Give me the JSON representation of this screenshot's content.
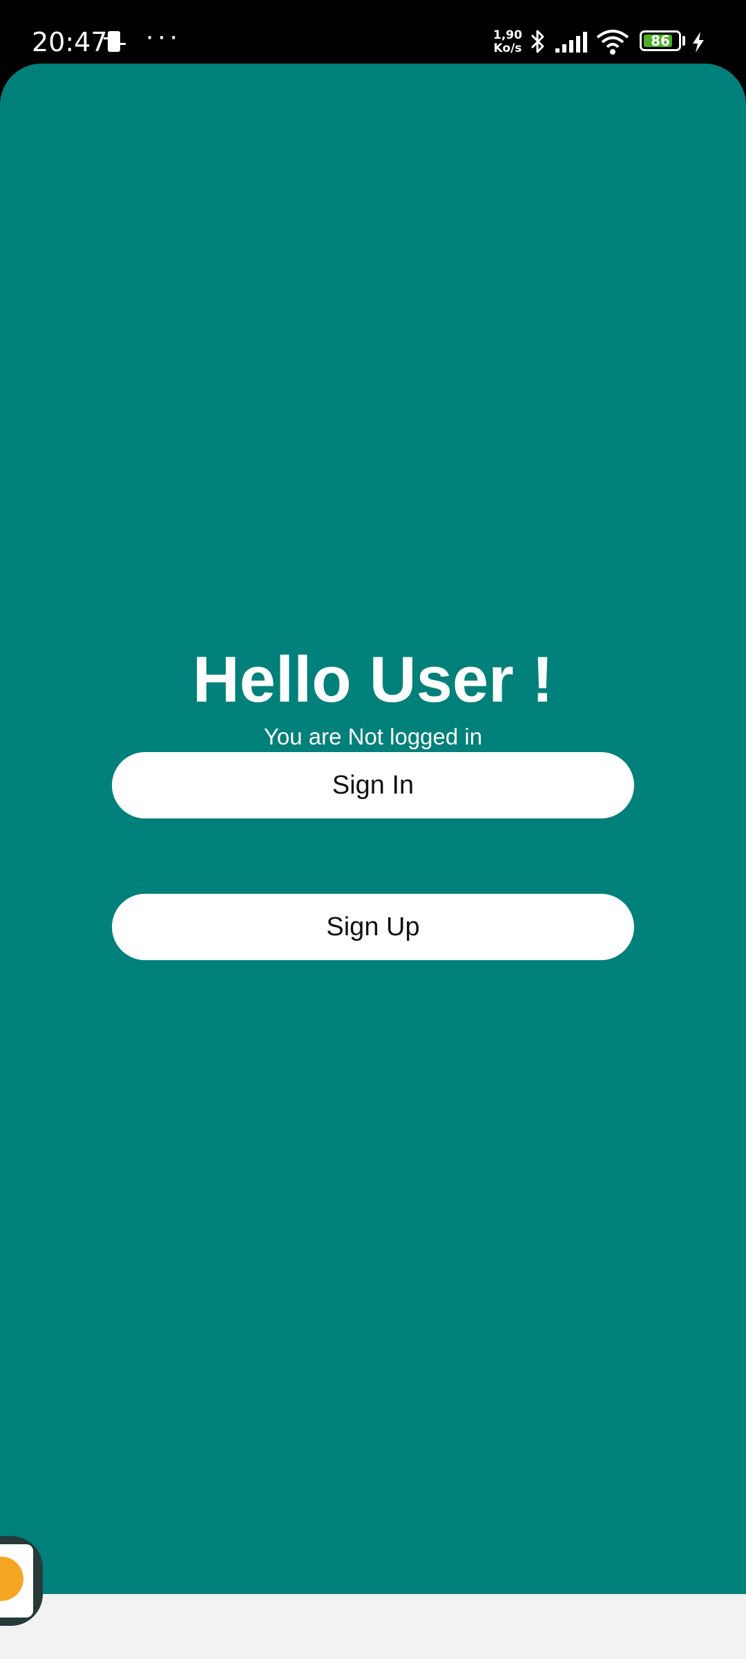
{
  "status_bar": {
    "time": "20:47",
    "more": "···",
    "net_speed_value": "1,90",
    "net_speed_unit": "Ko/s",
    "battery": "86",
    "battery_level": 0.86,
    "icons": [
      "phone-icon",
      "bluetooth-icon",
      "signal-icon",
      "wifi-icon",
      "battery-icon",
      "charging-icon"
    ]
  },
  "main": {
    "title": "Hello User !",
    "status": "You are Not logged in",
    "sign_in_label": "Sign In",
    "sign_up_label": "Sign Up"
  },
  "colors": {
    "background": "#00807a",
    "button": "#ffffff",
    "text_on_bg": "#ffffff",
    "button_text": "#111111",
    "battery_fill": "#4caf2a",
    "bottom_strip": "#f2f2f2",
    "float_icon": "#f5a623"
  }
}
